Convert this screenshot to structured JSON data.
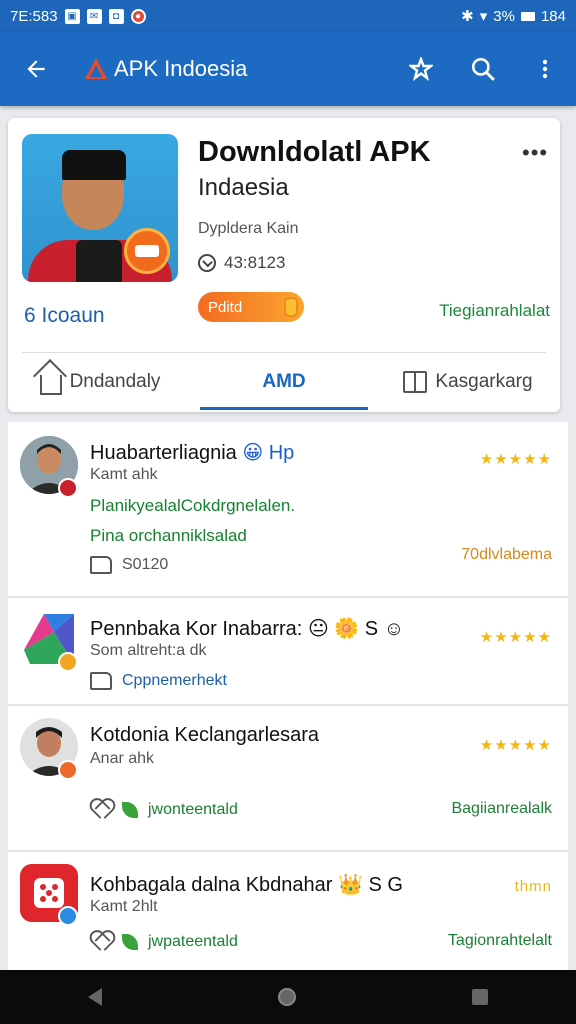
{
  "status_bar": {
    "time": "7E:583",
    "battery": "3%",
    "clock_right": "184"
  },
  "app_bar": {
    "title": "APK Indoesia",
    "back_icon": "arrow-left-icon",
    "actions": [
      "star-icon",
      "search-icon",
      "more-vert-icon"
    ]
  },
  "app_card": {
    "title": "Downldolatl APK",
    "subtitle": "Indaesia",
    "developer": "Dypldera Kain",
    "downloads": "43:8123",
    "left_label": "6 Icoaun",
    "install_label": "Pditd",
    "right_label": "Tiegianrahlalat",
    "more_icon": "more-horiz-icon"
  },
  "tabs": [
    {
      "label": "Dndandaly",
      "icon": "home-icon",
      "active": false
    },
    {
      "label": "AMD",
      "icon": "",
      "active": true
    },
    {
      "label": "Kasgarkarg",
      "icon": "book-icon",
      "active": false
    }
  ],
  "items": [
    {
      "name": "Huabarterliagnia",
      "name_extra": "😀 Hp",
      "sub": "Kamt ahk",
      "stars": "★★★★★",
      "line1": "PlanikyealalCokdrgnelalen.",
      "line2": "Pina orchanniklsalad",
      "count": "S0120",
      "right_text": "70dlvlabema"
    },
    {
      "name": "Pennbaka Kor Inabarra:",
      "name_extra": "😐 🌼 S ☺",
      "sub": "Som altreht:a dk",
      "stars": "★★★★★",
      "action": "Cppnemerhekt"
    },
    {
      "name": "Kotdonia Keclangarlesara",
      "sub": "Anar ahk",
      "stars": "★★★★★",
      "action": "jwonteentald",
      "right_text": "Bagiianrealalk"
    },
    {
      "name": "Kohbagala dalna Kbdnahar",
      "name_extra": "👑 S G",
      "sub": "Kamt 2hlt",
      "stars": "thmn",
      "action": "jwpateentald",
      "right_text": "Tagionrahtelalt"
    }
  ],
  "colors": {
    "app_bar": "#1d6ac2",
    "accent_blue": "#1d66c0",
    "green": "#16812f",
    "orange": "#f36b21",
    "star": "#f2b712"
  }
}
